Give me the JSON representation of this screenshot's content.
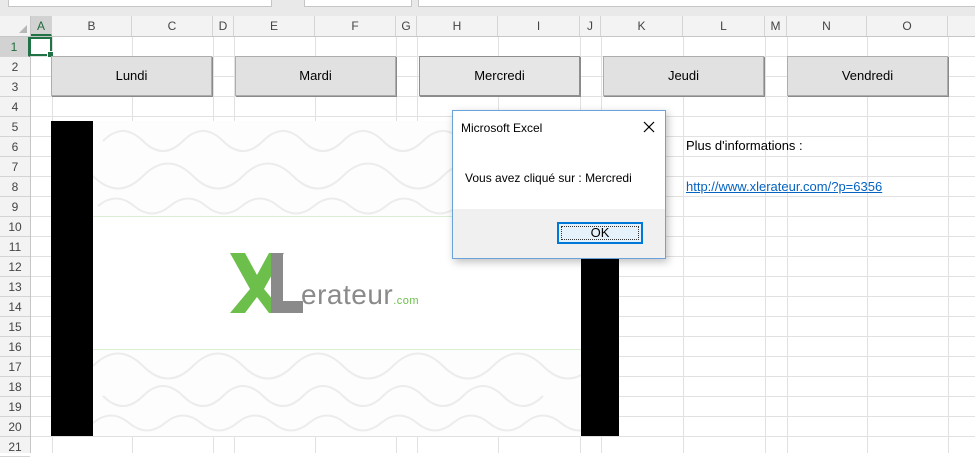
{
  "columns": [
    "A",
    "B",
    "C",
    "D",
    "E",
    "F",
    "G",
    "H",
    "I",
    "J",
    "K",
    "L",
    "M",
    "N",
    "O"
  ],
  "rows": [
    "1",
    "2",
    "3",
    "4",
    "5",
    "6",
    "7",
    "8",
    "9",
    "10",
    "11",
    "12",
    "13",
    "14",
    "15",
    "16",
    "17",
    "18",
    "19",
    "20",
    "21"
  ],
  "day_buttons": [
    "Lundi",
    "Mardi",
    "Mercredi",
    "Jeudi",
    "Vendredi"
  ],
  "info": {
    "label": "Plus d'informations :",
    "link": "http://www.xlerateur.com/?p=6356"
  },
  "logo": {
    "text": "XLerateur.com",
    "colors": {
      "green": "#6cbf4a",
      "gray": "#8a8a8a"
    }
  },
  "dialog": {
    "title": "Microsoft Excel",
    "message": "Vous avez cliqué sur : Mercredi",
    "ok_label": "OK"
  },
  "colors": {
    "excel_green": "#217346",
    "link": "#0563c1",
    "dialog_border": "#6aa3d9"
  }
}
